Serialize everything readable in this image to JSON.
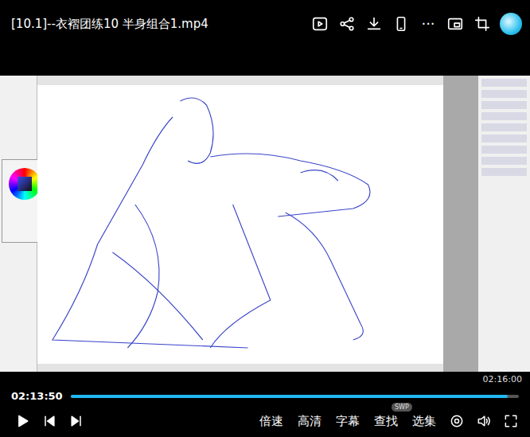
{
  "window": {
    "title": "[10.1]--衣褶团练10 半身组合1.mp4"
  },
  "more": "···",
  "player": {
    "playing": false,
    "current_time": "02:13:50",
    "total_time": "02:16:00",
    "level": 0.975
  },
  "controls": [
    {
      "label": "倍速",
      "badge": null
    },
    {
      "label": "高清",
      "badge": null
    },
    {
      "label": "字幕",
      "badge": null
    },
    {
      "label": "查找",
      "badge": "SWP"
    },
    {
      "label": "选集",
      "badge": null
    }
  ]
}
